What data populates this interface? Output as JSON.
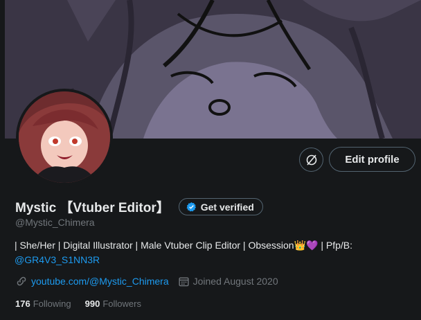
{
  "header": {
    "edit_profile_label": "Edit profile",
    "icon_button": "circle-slash-icon"
  },
  "profile": {
    "display_name": "Mystic 【Vtuber Editor】",
    "verify_label": "Get verified",
    "handle": "@Mystic_Chimera",
    "bio_text": "| She/Her | Digital Illustrator | Male Vtuber Clip Editor | Obsession",
    "bio_crown": "👑",
    "bio_heart": "💜",
    "bio_tail": " | Pfp/B:",
    "bio_mention": "@GR4V3_S1NN3R",
    "website": "youtube.com/@Mystic_Chimera",
    "joined": "Joined August 2020",
    "following_count": "176",
    "following_label": "Following",
    "followers_count": "990",
    "followers_label": "Followers"
  },
  "colors": {
    "background": "#16181a",
    "link": "#1d9bf0",
    "muted": "#71767b",
    "verified_badge": "#1d9bf0"
  }
}
